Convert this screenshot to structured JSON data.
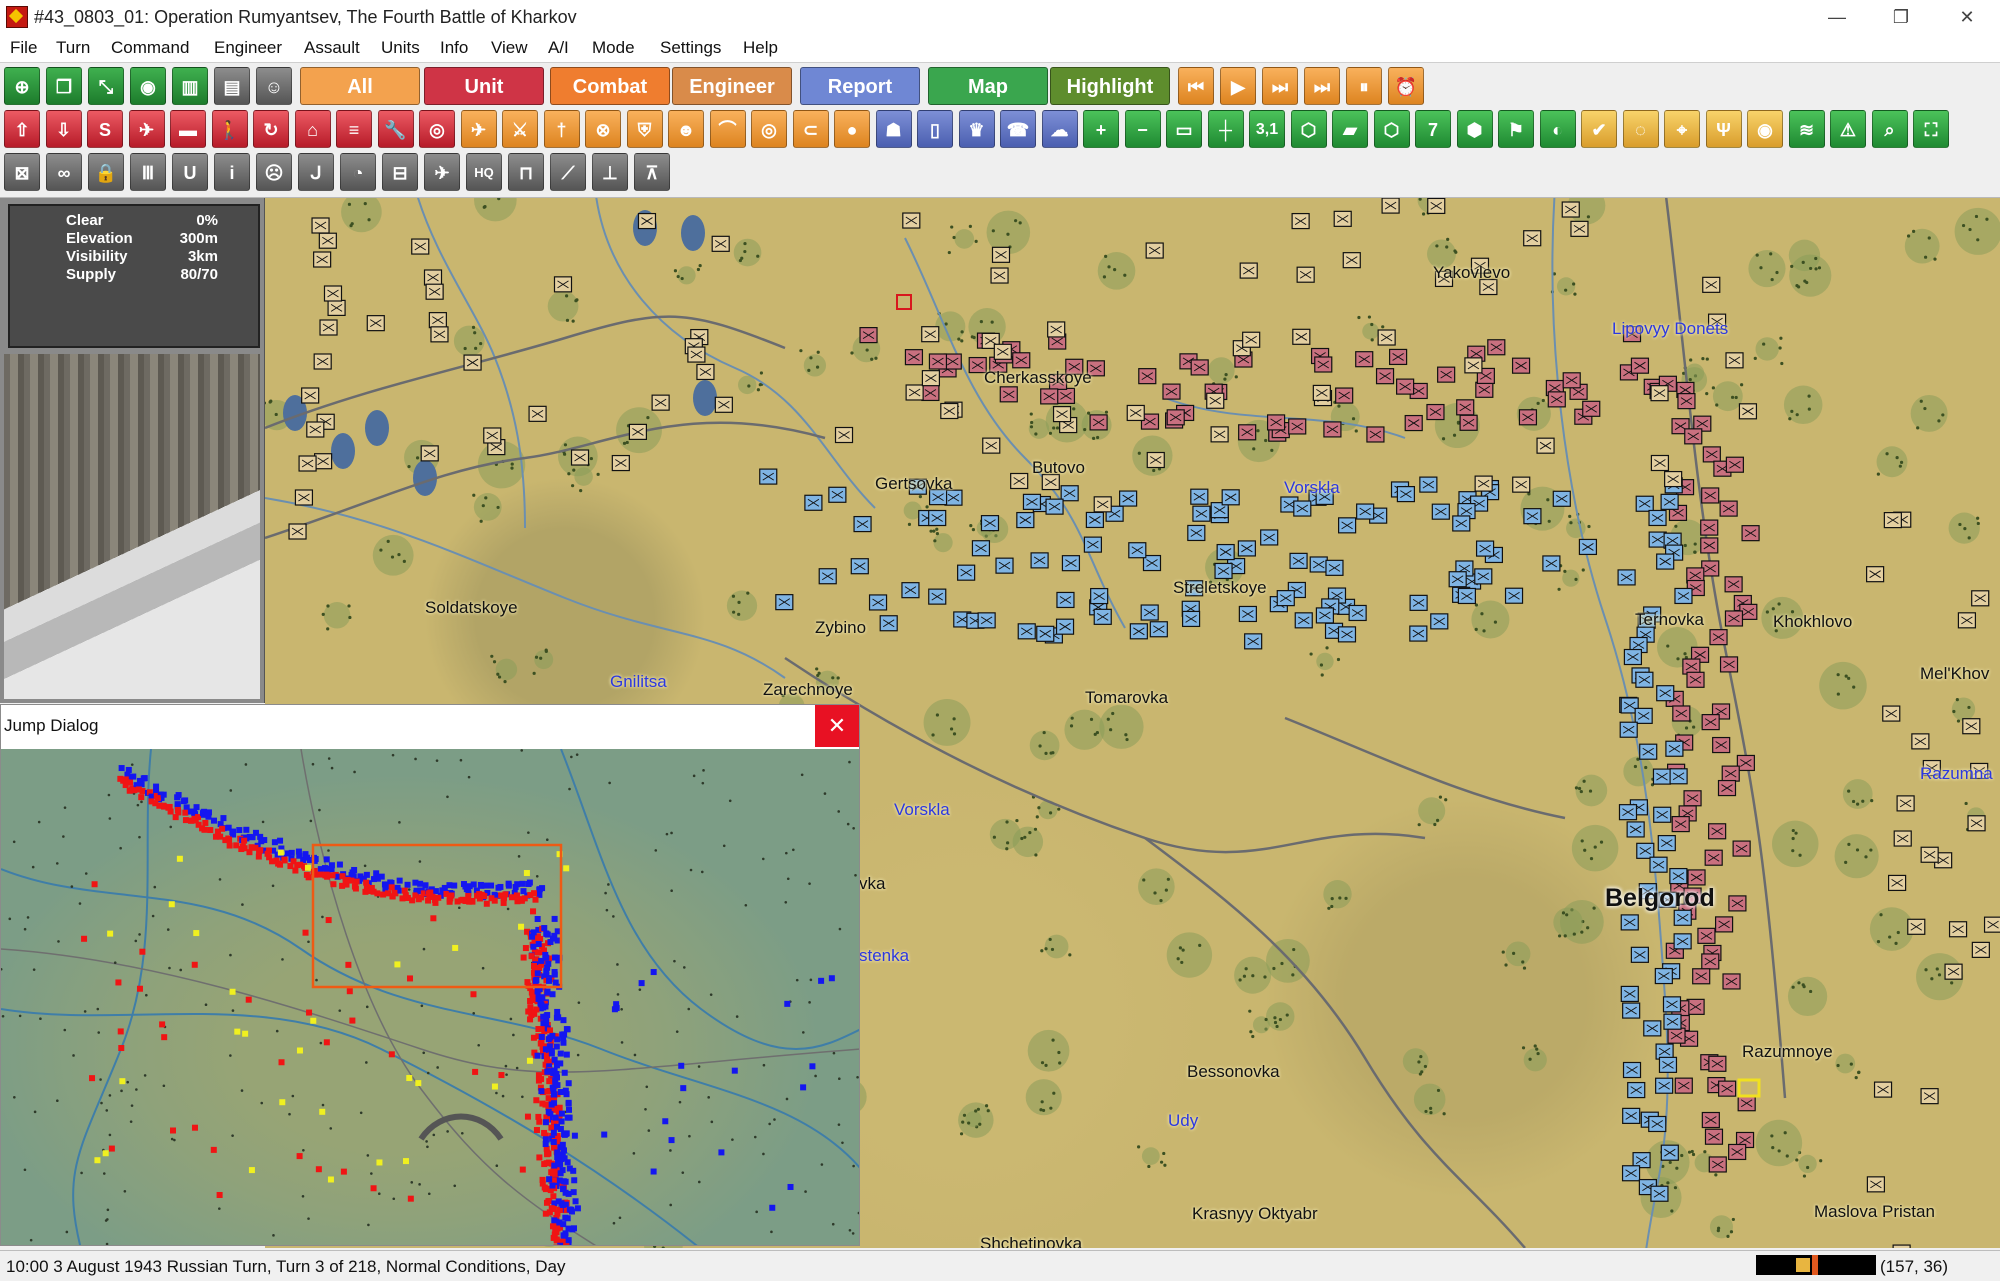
{
  "window": {
    "title": "#43_0803_01: Operation Rumyantsev, The Fourth Battle of Kharkov",
    "minimize": "—",
    "restore": "❐",
    "close": "✕"
  },
  "menu": [
    "File",
    "Turn",
    "Command",
    "Engineer",
    "Assault",
    "Units",
    "Info",
    "View",
    "A/I",
    "Mode",
    "Settings",
    "Help"
  ],
  "toolbar": {
    "mode_tabs": [
      {
        "label": "All",
        "color": "#f3a24e"
      },
      {
        "label": "Unit",
        "color": "#cf3446"
      },
      {
        "label": "Combat",
        "color": "#ef7d2f"
      },
      {
        "label": "Engineer",
        "color": "#d98b4a"
      },
      {
        "label": "Report",
        "color": "#6f87d4"
      },
      {
        "label": "Map",
        "color": "#3aa64e"
      },
      {
        "label": "Highlight",
        "color": "#5e8d2d"
      }
    ],
    "row1_icons": [
      "target-icon",
      "windows-icon",
      "resize-icon",
      "eye-icon",
      "map-book-icon",
      "card-icon",
      "portrait-icon"
    ],
    "row1_text_icons": [
      "",
      "",
      "",
      "",
      "",
      "",
      ""
    ],
    "playback_icons": [
      "rewind-icon",
      "play-icon",
      "fast-forward-icon",
      "skip-end-icon",
      "pause-icon",
      "alarm-icon"
    ],
    "row2_icons": [
      "upload-icon",
      "download-icon",
      "s-box-icon",
      "plane-up-icon",
      "tank-icon",
      "walking-man-icon",
      "rotate-icon",
      "door-icon",
      "list-icon",
      "wrench-icon",
      "binoculars-icon",
      "plane-icon",
      "swords-icon",
      "sword-icon",
      "crosshair-icon",
      "shield-icon",
      "face-icon",
      "arc-icon",
      "ring-icon",
      "bread-icon",
      "grenade-icon",
      "people-icon",
      "book-icon",
      "trophy-icon",
      "phone-icon",
      "cloud-icon",
      "plus-icon",
      "minus-icon",
      "monitor-icon",
      "signpost-icon",
      "hex-icon",
      "hex-33-icon",
      "terrain-icon",
      "hex-20-icon",
      "seven-icon",
      "hexagon-icon",
      "flag-icon",
      "contrast-icon",
      "check-wing-icon",
      "coin-icon",
      "crosshair-2-icon",
      "antenna-icon",
      "dot-ring-icon",
      "layers-icon",
      "warning-icon",
      "magnifier-icon",
      "fullscreen-icon"
    ],
    "row2_labels": {
      "coords": "3,1",
      "seven": "7"
    },
    "row3_icons": [
      "box-x-icon",
      "link-icon",
      "lock-icon",
      "ammo-icon",
      "u-icon",
      "info-icon",
      "frown-icon",
      "arm-icon",
      "pie-icon",
      "minus-box-icon",
      "plane-down-icon",
      "hq-icon",
      "bracket-icon",
      "angle-icon",
      "tree-icon",
      "tri-tree-icon"
    ]
  },
  "terrain_info": {
    "rows": [
      {
        "label": "Clear",
        "value": "0%"
      },
      {
        "label": "Elevation",
        "value": "300m"
      },
      {
        "label": "Visibility",
        "value": "3km"
      },
      {
        "label": "Supply",
        "value": "80/70"
      }
    ]
  },
  "map_labels": {
    "towns": [
      "Yakovlevo",
      "Cherkasskoye",
      "Butovo",
      "Gertsovka",
      "Streletskoye",
      "Soldatskoye",
      "Zybino",
      "Zarechnoye",
      "Tomarovka",
      "Ternovka",
      "Khokhlovo",
      "Mel'Khov",
      "Razumnoye",
      "Bessonovka",
      "Krasnyy Oktyabr",
      "Maslova Pristan",
      "Shchetinovka",
      "vka"
    ],
    "rivers": [
      "Lipovyy Donets",
      "Vorskla",
      "Vorskla",
      "Gnilitsa",
      "Udy",
      "Razumna",
      "stenka"
    ],
    "city": "Belgorod"
  },
  "jump_dialog": {
    "title": "Jump Dialog",
    "close": "✕"
  },
  "status": {
    "text": "10:00 3 August 1943 Russian Turn, Turn 3 of 218, Normal Conditions, Day",
    "coords": "(157, 36)"
  },
  "colors": {
    "axis_counter": "#c9707f",
    "soviet_counter": "#7fb4e3",
    "hq_counter": "#e3cfa0",
    "river_label": "#2c38e0"
  }
}
